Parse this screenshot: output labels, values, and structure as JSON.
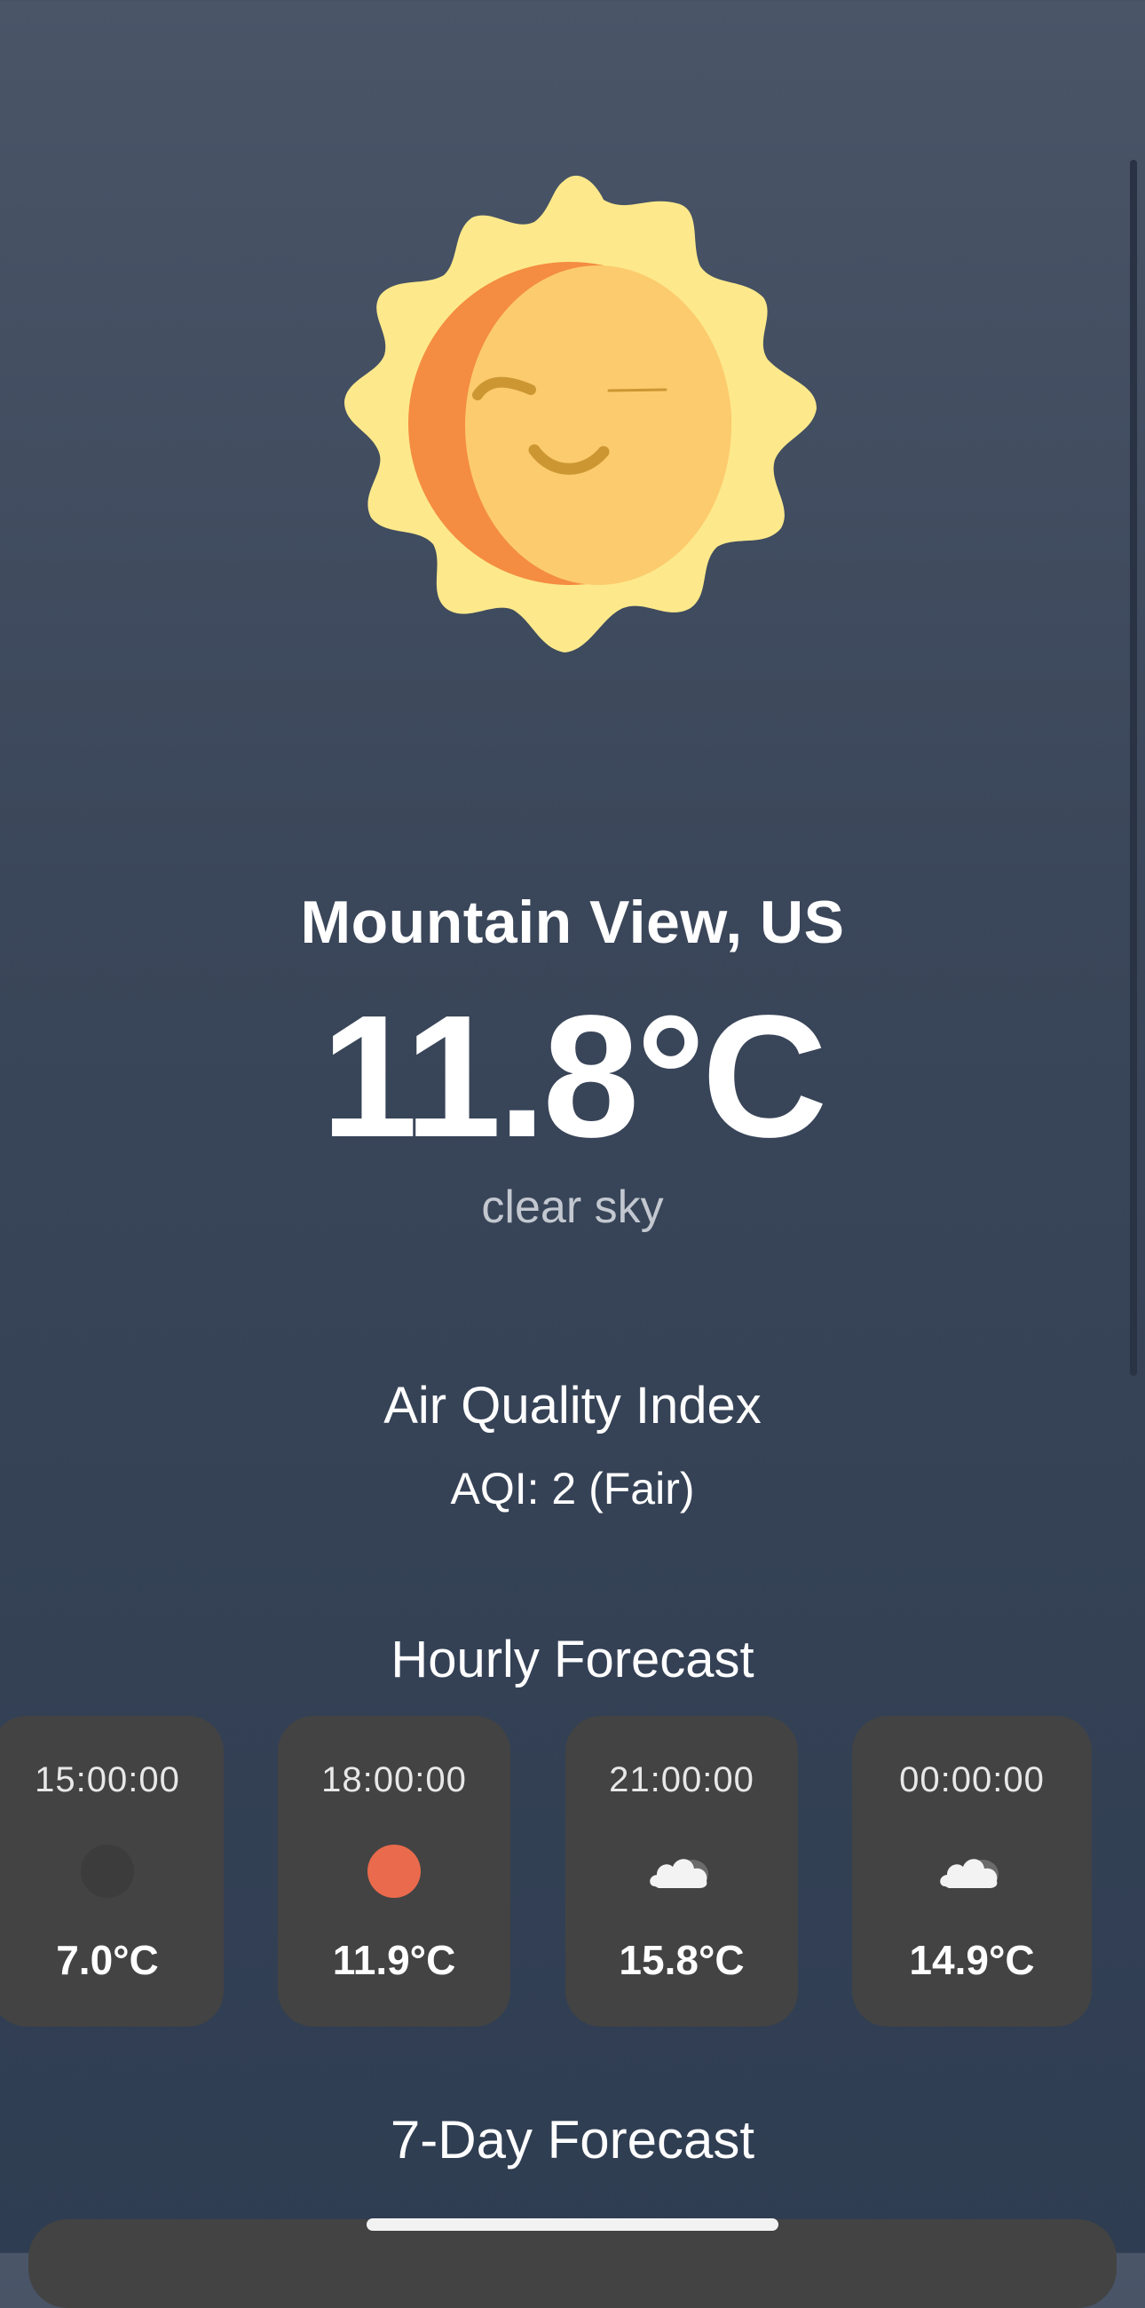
{
  "current": {
    "location": "Mountain View, US",
    "temperature": "11.8°C",
    "description": "clear sky",
    "icon": "smiling-sun-icon"
  },
  "air_quality": {
    "title": "Air Quality Index",
    "value": "AQI: 2 (Fair)"
  },
  "hourly": {
    "title": "Hourly Forecast",
    "items": [
      {
        "time": "15:00:00",
        "temp": "7.0°C",
        "icon": "dark-circle-icon"
      },
      {
        "time": "18:00:00",
        "temp": "11.9°C",
        "icon": "sun-dot-icon"
      },
      {
        "time": "21:00:00",
        "temp": "15.8°C",
        "icon": "cloud-icon"
      },
      {
        "time": "00:00:00",
        "temp": "14.9°C",
        "icon": "cloud-icon"
      }
    ]
  },
  "weekly": {
    "title": "7-Day Forecast"
  },
  "colors": {
    "card_background": "#434343",
    "sun_rays": "#fde98b",
    "sun_face": "#fccb6e",
    "sun_shadow": "#f48c41",
    "hourly_sun_dot": "#e96a4c"
  }
}
